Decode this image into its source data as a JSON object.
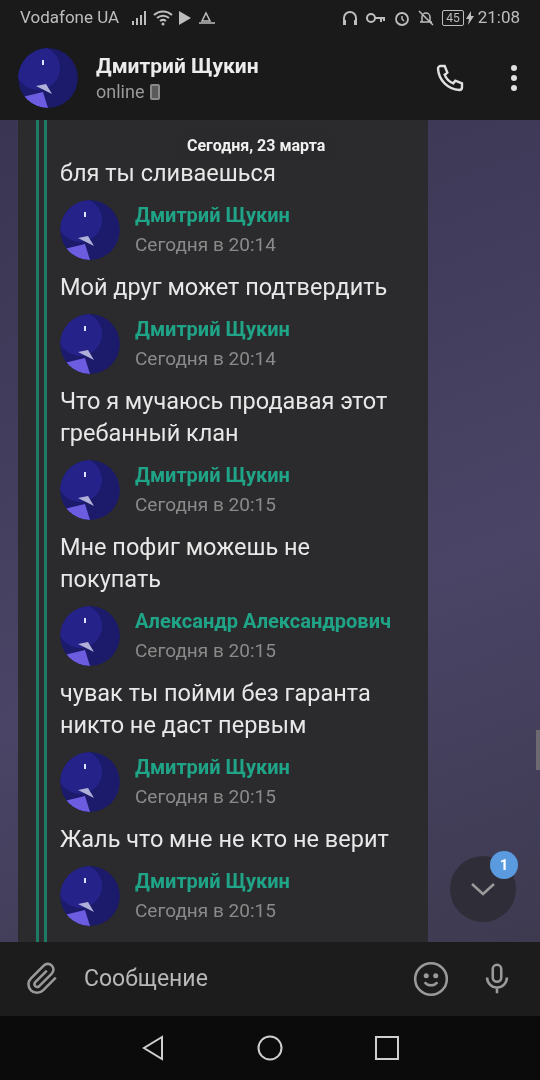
{
  "status_bar": {
    "carrier": "Vodafone UA",
    "battery": "45",
    "time": "21:08"
  },
  "header": {
    "title": "Дмитрий Щукин",
    "subtitle": "online"
  },
  "date_pill": "Сегодня, 23 марта",
  "messages": [
    {
      "kind": "text",
      "text": "бля ты сливаешься"
    },
    {
      "kind": "header",
      "sender": "Дмитрий Щукин",
      "time": "Сегодня в 20:14"
    },
    {
      "kind": "text",
      "text": "Мой друг может подтвердить"
    },
    {
      "kind": "header",
      "sender": "Дмитрий Щукин",
      "time": "Сегодня в 20:14"
    },
    {
      "kind": "text",
      "text": "Что я мучаюсь продавая этот гребанный клан"
    },
    {
      "kind": "header",
      "sender": "Дмитрий Щукин",
      "time": "Сегодня в 20:15"
    },
    {
      "kind": "text",
      "text": "Мне пофиг можешь не покупать"
    },
    {
      "kind": "header",
      "sender": "Александр Александрович",
      "time": "Сегодня в 20:15"
    },
    {
      "kind": "text",
      "text": "чувак ты пойми без гаранта никто не даст первым"
    },
    {
      "kind": "header",
      "sender": "Дмитрий Щукин",
      "time": "Сегодня в 20:15"
    },
    {
      "kind": "text",
      "text": "Жаль что мне не кто не верит"
    },
    {
      "kind": "header",
      "sender": "Дмитрий Щукин",
      "time": "Сегодня в 20:15"
    }
  ],
  "unread_badge": "1",
  "composer": {
    "placeholder": "Сообщение"
  }
}
